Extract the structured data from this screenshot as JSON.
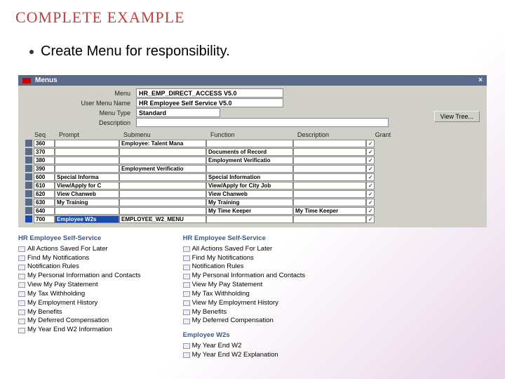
{
  "slide": {
    "title": "COMPLETE EXAMPLE",
    "bullet": "Create Menu for responsibility."
  },
  "window": {
    "title": "Menus",
    "close": "×",
    "view_tree": "View Tree...",
    "labels": {
      "menu": "Menu",
      "user_menu_name": "User Menu Name",
      "menu_type": "Menu Type",
      "description": "Description"
    },
    "fields": {
      "menu": "HR_EMP_DIRECT_ACCESS V5.0",
      "user_menu_name": "HR Employee Self Service V5.0",
      "menu_type": "Standard",
      "description": ""
    },
    "grid_headers": {
      "seq": "Seq",
      "prompt": "Prompt",
      "submenu": "Submenu",
      "function": "Function",
      "description": "Description",
      "grant": "Grant"
    },
    "rows": [
      {
        "seq": "360",
        "prompt": "",
        "submenu": "Employee: Talent Mana",
        "function": "",
        "description": "",
        "grant": "✓"
      },
      {
        "seq": "370",
        "prompt": "",
        "submenu": "",
        "function": "Documents of Record",
        "description": "",
        "grant": "✓"
      },
      {
        "seq": "380",
        "prompt": "",
        "submenu": "",
        "function": "Employment Verificatio",
        "description": "",
        "grant": "✓"
      },
      {
        "seq": "390",
        "prompt": "",
        "submenu": "Employment Verificatio",
        "function": "",
        "description": "",
        "grant": "✓"
      },
      {
        "seq": "600",
        "prompt": "Special Informa",
        "submenu": "",
        "function": "Special Information",
        "description": "",
        "grant": "✓"
      },
      {
        "seq": "610",
        "prompt": "View/Apply for C",
        "submenu": "",
        "function": "View/Apply for City Job",
        "description": "",
        "grant": "✓"
      },
      {
        "seq": "620",
        "prompt": "View Chanweb",
        "submenu": "",
        "function": "View Chanweb",
        "description": "",
        "grant": "✓"
      },
      {
        "seq": "630",
        "prompt": "My Training",
        "submenu": "",
        "function": "My Training",
        "description": "",
        "grant": "✓"
      },
      {
        "seq": "640",
        "prompt": "",
        "submenu": "",
        "function": "My Time Keeper",
        "description": "My Time Keeper",
        "grant": "✓"
      },
      {
        "seq": "700",
        "prompt": "Employee W2s",
        "submenu": "EMPLOYEE_W2_MENU",
        "function": "",
        "description": "",
        "grant": "✓",
        "selected": true
      }
    ]
  },
  "left_menu": {
    "title": "HR Employee Self-Service",
    "items": [
      "All Actions Saved For Later",
      "Find My Notifications",
      "Notification Rules",
      "My Personal Information and Contacts",
      "View My Pay Statement",
      "My Tax Withholding",
      "My Employment History",
      "My Benefits",
      "My Deferred Compensation",
      "My Year End W2 Information"
    ]
  },
  "right_menu": {
    "title": "HR Employee Self-Service",
    "items": [
      "All Actions Saved For Later",
      "Find My Notifications",
      "Notification Rules",
      "My Personal Information and Contacts",
      "View My Pay Statement",
      "My Tax Withholding",
      "View My Employment History",
      "My Benefits",
      "My Deferred Compensation"
    ],
    "sub_title": "Employee W2s",
    "sub_items": [
      "My Year End W2",
      "My Year End W2 Explanation"
    ]
  }
}
